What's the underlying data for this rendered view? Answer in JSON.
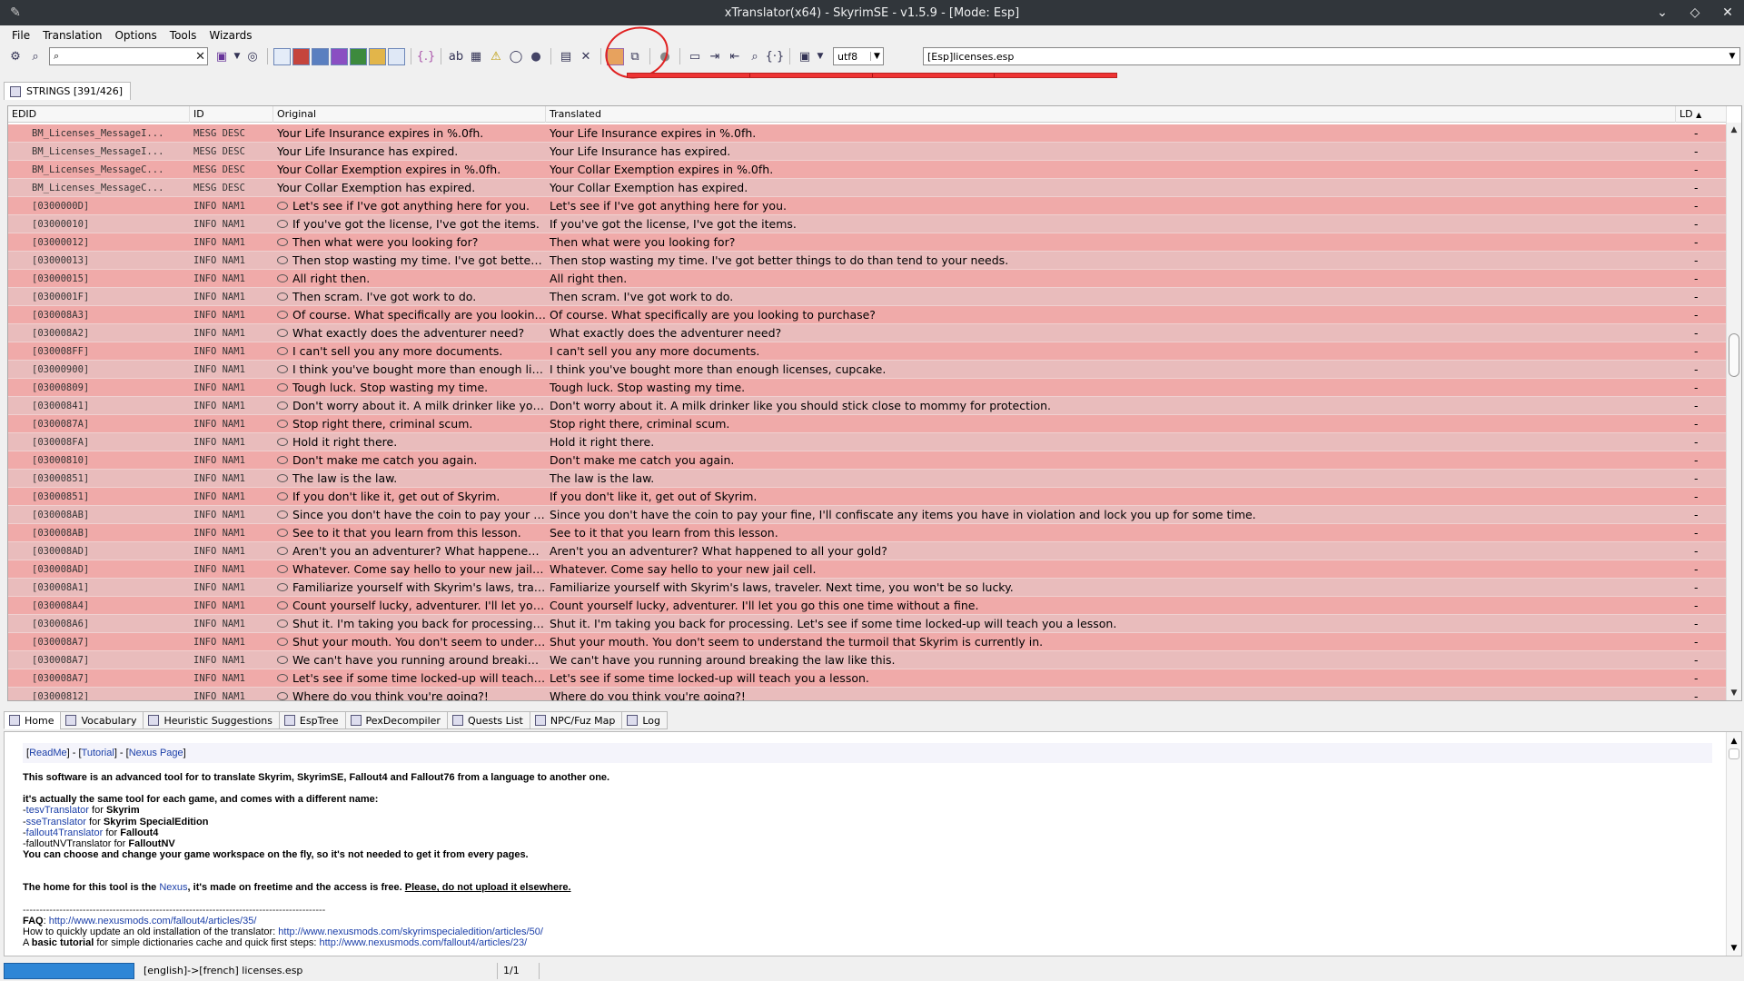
{
  "window": {
    "title": "xTranslator(x64) - SkyrimSE - v1.5.9 - [Mode: Esp]"
  },
  "menu": [
    "File",
    "Translation",
    "Options",
    "Tools",
    "Wizards"
  ],
  "toolbar": {
    "search_value": "",
    "encoding": "utf8",
    "file": "[Esp]licenses.esp"
  },
  "tab": {
    "label": "STRINGS [391/426]"
  },
  "columns": {
    "edid": "EDID",
    "id": "ID",
    "original": "Original",
    "translated": "Translated",
    "ld": "LD"
  },
  "rows": [
    {
      "edid": "BM_Licenses_MessageI...",
      "id": "MESG DESC",
      "original": "Your Life Insurance expires in %.0fh.",
      "translated": "Your Life Insurance expires in %.0fh.",
      "ld": "-",
      "dialog": false
    },
    {
      "edid": "BM_Licenses_MessageI...",
      "id": "MESG DESC",
      "original": "Your Life Insurance has expired.",
      "translated": "Your Life Insurance has expired.",
      "ld": "-",
      "dialog": false
    },
    {
      "edid": "BM_Licenses_MessageC...",
      "id": "MESG DESC",
      "original": "Your Collar Exemption expires in %.0fh.",
      "translated": "Your Collar Exemption expires in %.0fh.",
      "ld": "-",
      "dialog": false
    },
    {
      "edid": "BM_Licenses_MessageC...",
      "id": "MESG DESC",
      "original": "Your Collar Exemption has expired.",
      "translated": "Your Collar Exemption has expired.",
      "ld": "-",
      "dialog": false
    },
    {
      "edid": "[0300000D]",
      "id": "INFO NAM1",
      "original": "Let's see if I've got anything here for you.",
      "translated": "Let's see if I've got anything here for you.",
      "ld": "-",
      "dialog": true
    },
    {
      "edid": "[03000010]",
      "id": "INFO NAM1",
      "original": "If you've got the license, I've got the items.",
      "translated": "If you've got the license, I've got the items.",
      "ld": "-",
      "dialog": true
    },
    {
      "edid": "[03000012]",
      "id": "INFO NAM1",
      "original": "Then what were you looking for?",
      "translated": "Then what were you looking for?",
      "ld": "-",
      "dialog": true
    },
    {
      "edid": "[03000013]",
      "id": "INFO NAM1",
      "original": "Then stop wasting my time. I've got better ...",
      "translated": "Then stop wasting my time. I've got better things to do than tend to your needs.",
      "ld": "-",
      "dialog": true
    },
    {
      "edid": "[03000015]",
      "id": "INFO NAM1",
      "original": "All right then.",
      "translated": "All right then.",
      "ld": "-",
      "dialog": true
    },
    {
      "edid": "[0300001F]",
      "id": "INFO NAM1",
      "original": "Then scram. I've got work to do.",
      "translated": "Then scram. I've got work to do.",
      "ld": "-",
      "dialog": true
    },
    {
      "edid": "[030008A3]",
      "id": "INFO NAM1",
      "original": "Of course. What specifically are you looking...",
      "translated": "Of course. What specifically are you looking to purchase?",
      "ld": "-",
      "dialog": true
    },
    {
      "edid": "[030008A2]",
      "id": "INFO NAM1",
      "original": "What exactly does the adventurer need?",
      "translated": "What exactly does the adventurer need?",
      "ld": "-",
      "dialog": true
    },
    {
      "edid": "[030008FF]",
      "id": "INFO NAM1",
      "original": "I can't sell you any more documents.",
      "translated": "I can't sell you any more documents.",
      "ld": "-",
      "dialog": true
    },
    {
      "edid": "[03000900]",
      "id": "INFO NAM1",
      "original": "I think you've bought more than enough lice...",
      "translated": "I think you've bought more than enough licenses, cupcake.",
      "ld": "-",
      "dialog": true
    },
    {
      "edid": "[03000809]",
      "id": "INFO NAM1",
      "original": "Tough luck. Stop wasting my time.",
      "translated": "Tough luck. Stop wasting my time.",
      "ld": "-",
      "dialog": true
    },
    {
      "edid": "[03000841]",
      "id": "INFO NAM1",
      "original": "Don't worry about it. A milk drinker like you...",
      "translated": "Don't worry about it. A milk drinker like you should stick close to mommy for protection.",
      "ld": "-",
      "dialog": true
    },
    {
      "edid": "[0300087A]",
      "id": "INFO NAM1",
      "original": "Stop right there, criminal scum.",
      "translated": "Stop right there, criminal scum.",
      "ld": "-",
      "dialog": true
    },
    {
      "edid": "[030008FA]",
      "id": "INFO NAM1",
      "original": "Hold it right there.",
      "translated": "Hold it right there.",
      "ld": "-",
      "dialog": true
    },
    {
      "edid": "[03000810]",
      "id": "INFO NAM1",
      "original": "Don't make me catch you again.",
      "translated": "Don't make me catch you again.",
      "ld": "-",
      "dialog": true
    },
    {
      "edid": "[03000851]",
      "id": "INFO NAM1",
      "original": "The law is the law.",
      "translated": "The law is the law.",
      "ld": "-",
      "dialog": true
    },
    {
      "edid": "[03000851]",
      "id": "INFO NAM1",
      "original": "If you don't like it, get out of Skyrim.",
      "translated": "If you don't like it, get out of Skyrim.",
      "ld": "-",
      "dialog": true
    },
    {
      "edid": "[030008AB]",
      "id": "INFO NAM1",
      "original": "Since you don't have the coin to pay your fi...",
      "translated": "Since you don't have the coin to pay your fine, I'll confiscate any items you have in violation and lock you up for some time.",
      "ld": "-",
      "dialog": true
    },
    {
      "edid": "[030008AB]",
      "id": "INFO NAM1",
      "original": "See to it that you learn from this lesson.",
      "translated": "See to it that you learn from this lesson.",
      "ld": "-",
      "dialog": true
    },
    {
      "edid": "[030008AD]",
      "id": "INFO NAM1",
      "original": "Aren't you an adventurer? What happened t...",
      "translated": "Aren't you an adventurer? What happened to all your gold?",
      "ld": "-",
      "dialog": true
    },
    {
      "edid": "[030008AD]",
      "id": "INFO NAM1",
      "original": "Whatever. Come say hello to your new jail ...",
      "translated": "Whatever. Come say hello to your new jail cell.",
      "ld": "-",
      "dialog": true
    },
    {
      "edid": "[030008A1]",
      "id": "INFO NAM1",
      "original": "Familiarize yourself with Skyrim's laws, trav...",
      "translated": "Familiarize yourself with Skyrim's laws, traveler. Next time, you won't be so lucky.",
      "ld": "-",
      "dialog": true
    },
    {
      "edid": "[030008A4]",
      "id": "INFO NAM1",
      "original": "Count yourself lucky, adventurer. I'll let you...",
      "translated": "Count yourself lucky, adventurer. I'll let you go this one time without a fine.",
      "ld": "-",
      "dialog": true
    },
    {
      "edid": "[030008A6]",
      "id": "INFO NAM1",
      "original": "Shut it. I'm taking you back for processing. ...",
      "translated": "Shut it. I'm taking you back for processing. Let's see if some time locked-up will teach you a lesson.",
      "ld": "-",
      "dialog": true
    },
    {
      "edid": "[030008A7]",
      "id": "INFO NAM1",
      "original": "Shut your mouth. You don't seem to unders...",
      "translated": "Shut your mouth. You don't seem to understand the turmoil that Skyrim is currently in.",
      "ld": "-",
      "dialog": true
    },
    {
      "edid": "[030008A7]",
      "id": "INFO NAM1",
      "original": "We can't have you running around breaking...",
      "translated": "We can't have you running around breaking the law like this.",
      "ld": "-",
      "dialog": true
    },
    {
      "edid": "[030008A7]",
      "id": "INFO NAM1",
      "original": "Let's see if some time locked-up will teach ...",
      "translated": "Let's see if some time locked-up will teach you a lesson.",
      "ld": "-",
      "dialog": true
    },
    {
      "edid": "[03000812]",
      "id": "INFO NAM1",
      "original": "Where do you think you're going?!",
      "translated": "Where do you think you're going?!",
      "ld": "-",
      "dialog": true
    }
  ],
  "bottom_tabs": [
    "Home",
    "Vocabulary",
    "Heuristic Suggestions",
    "EspTree",
    "PexDecompiler",
    "Quests List",
    "NPC/Fuz Map",
    "Log"
  ],
  "home": {
    "link_readme": "ReadMe",
    "link_tutorial": "Tutorial",
    "link_nexus_page": "Nexus Page",
    "intro": "This software is an advanced tool for to translate Skyrim, SkyrimSE, Fallout4 and Fallout76 from a language to another one.",
    "same_tool": "it's actually the same tool for each game, and comes with a different name:",
    "tools": [
      {
        "name": "tesvTranslator",
        "for": "for",
        "game": "Skyrim"
      },
      {
        "name": "sseTranslator",
        "for": "for",
        "game": "Skyrim SpecialEdition"
      },
      {
        "name": "fallout4Translator",
        "for": "for",
        "game": "Fallout4"
      },
      {
        "name": "falloutNVTranslator",
        "for": "for",
        "game": "FalloutNV"
      }
    ],
    "workspace": "You can choose and change your game workspace on the fly, so it's not needed to get it from every pages.",
    "home_prefix": "The home for this tool is the",
    "home_link": "Nexus",
    "home_suffix": ", it's made on freetime and the access is free.",
    "home_warn": "Please, do not upload it elsewhere.",
    "rule": "-------------------------------------------------------------------------------------------",
    "faq_label": "FAQ",
    "faq_link": "http://www.nexusmods.com/fallout4/articles/35/",
    "update_text": "How to quickly update an old installation of the translator:",
    "update_link": "http://www.nexusmods.com/skyrimspecialedition/articles/50/",
    "tutorial_a": "A",
    "tutorial_bold": "basic tutorial",
    "tutorial_text": "for simple dictionaries cache and quick first steps:",
    "tutorial_link": "http://www.nexusmods.com/fallout4/articles/23/"
  },
  "status": {
    "text": "[english]->[french] licenses.esp",
    "page": "1/1"
  }
}
